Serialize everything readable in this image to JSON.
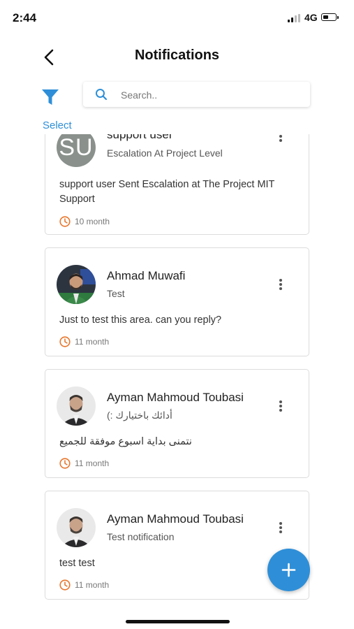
{
  "status_bar": {
    "time": "2:44",
    "network": "4G"
  },
  "header": {
    "title": "Notifications"
  },
  "toolbar": {
    "select_label": "Select",
    "search_placeholder": "Search.."
  },
  "colors": {
    "accent": "#2e8fd8",
    "clock": "#e8772e"
  },
  "notifications": [
    {
      "avatar_initials": "SU",
      "name": "support user",
      "subject": "Escalation At Project Level",
      "body": "support user Sent Escalation at The Project MIT Support",
      "time": "10 month"
    },
    {
      "name": "Ahmad Muwafi",
      "subject": "Test",
      "body": "Just to test this area. can you reply?",
      "time": "11 month"
    },
    {
      "name": "Ayman Mahmoud Toubasi",
      "subject": "(: أدائك باختيارك",
      "body": "نتمنى بداية اسبوع موفقة للجميع",
      "time": "11 month"
    },
    {
      "name": "Ayman Mahmoud Toubasi",
      "subject": "Test notification",
      "body": "test test",
      "time": "11 month"
    }
  ],
  "fab": {
    "icon": "plus-icon"
  }
}
